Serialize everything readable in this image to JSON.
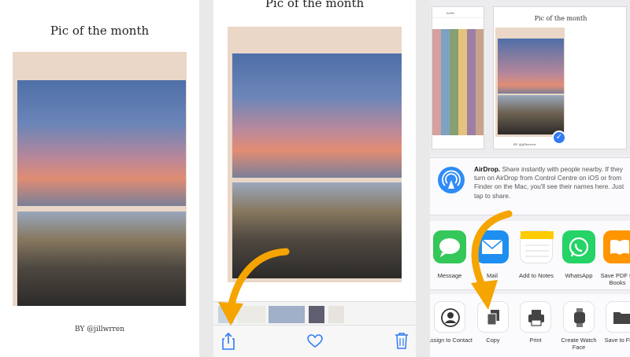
{
  "panel1": {
    "title": "Pic of the month",
    "byline": "BY @jillwrren"
  },
  "panel2": {
    "title": "Pic of the month",
    "toolbar": {
      "share_icon": "share-icon",
      "favorite_icon": "heart-icon",
      "delete_icon": "trash-icon"
    }
  },
  "panel3": {
    "preview": {
      "app_label": "buffer",
      "page_title": "Pic of the month",
      "byline": "BY @jillwrren"
    },
    "airdrop": {
      "title": "AirDrop.",
      "text": " Share instantly with people nearby. If they turn on AirDrop from Control Centre on iOS or from Finder on the Mac, you'll see their names here. Just tap to share."
    },
    "apps": [
      {
        "label": "Message",
        "color": "#34c759"
      },
      {
        "label": "Mail",
        "color": "#1f8ef1"
      },
      {
        "label": "Add to Notes",
        "color": "#ffffff"
      },
      {
        "label": "WhatsApp",
        "color": "#25d366"
      },
      {
        "label": "Save PDF to Books",
        "color": "#ff9500"
      }
    ],
    "actions": [
      {
        "label": "Assign to Contact",
        "icon": "contact-icon"
      },
      {
        "label": "Copy",
        "icon": "copy-icon"
      },
      {
        "label": "Print",
        "icon": "printer-icon"
      },
      {
        "label": "Create Watch Face",
        "icon": "watch-icon"
      },
      {
        "label": "Save to Files",
        "icon": "folder-icon"
      }
    ]
  },
  "colors": {
    "accent": "#2f7cf6",
    "arrow": "#f5a400"
  }
}
